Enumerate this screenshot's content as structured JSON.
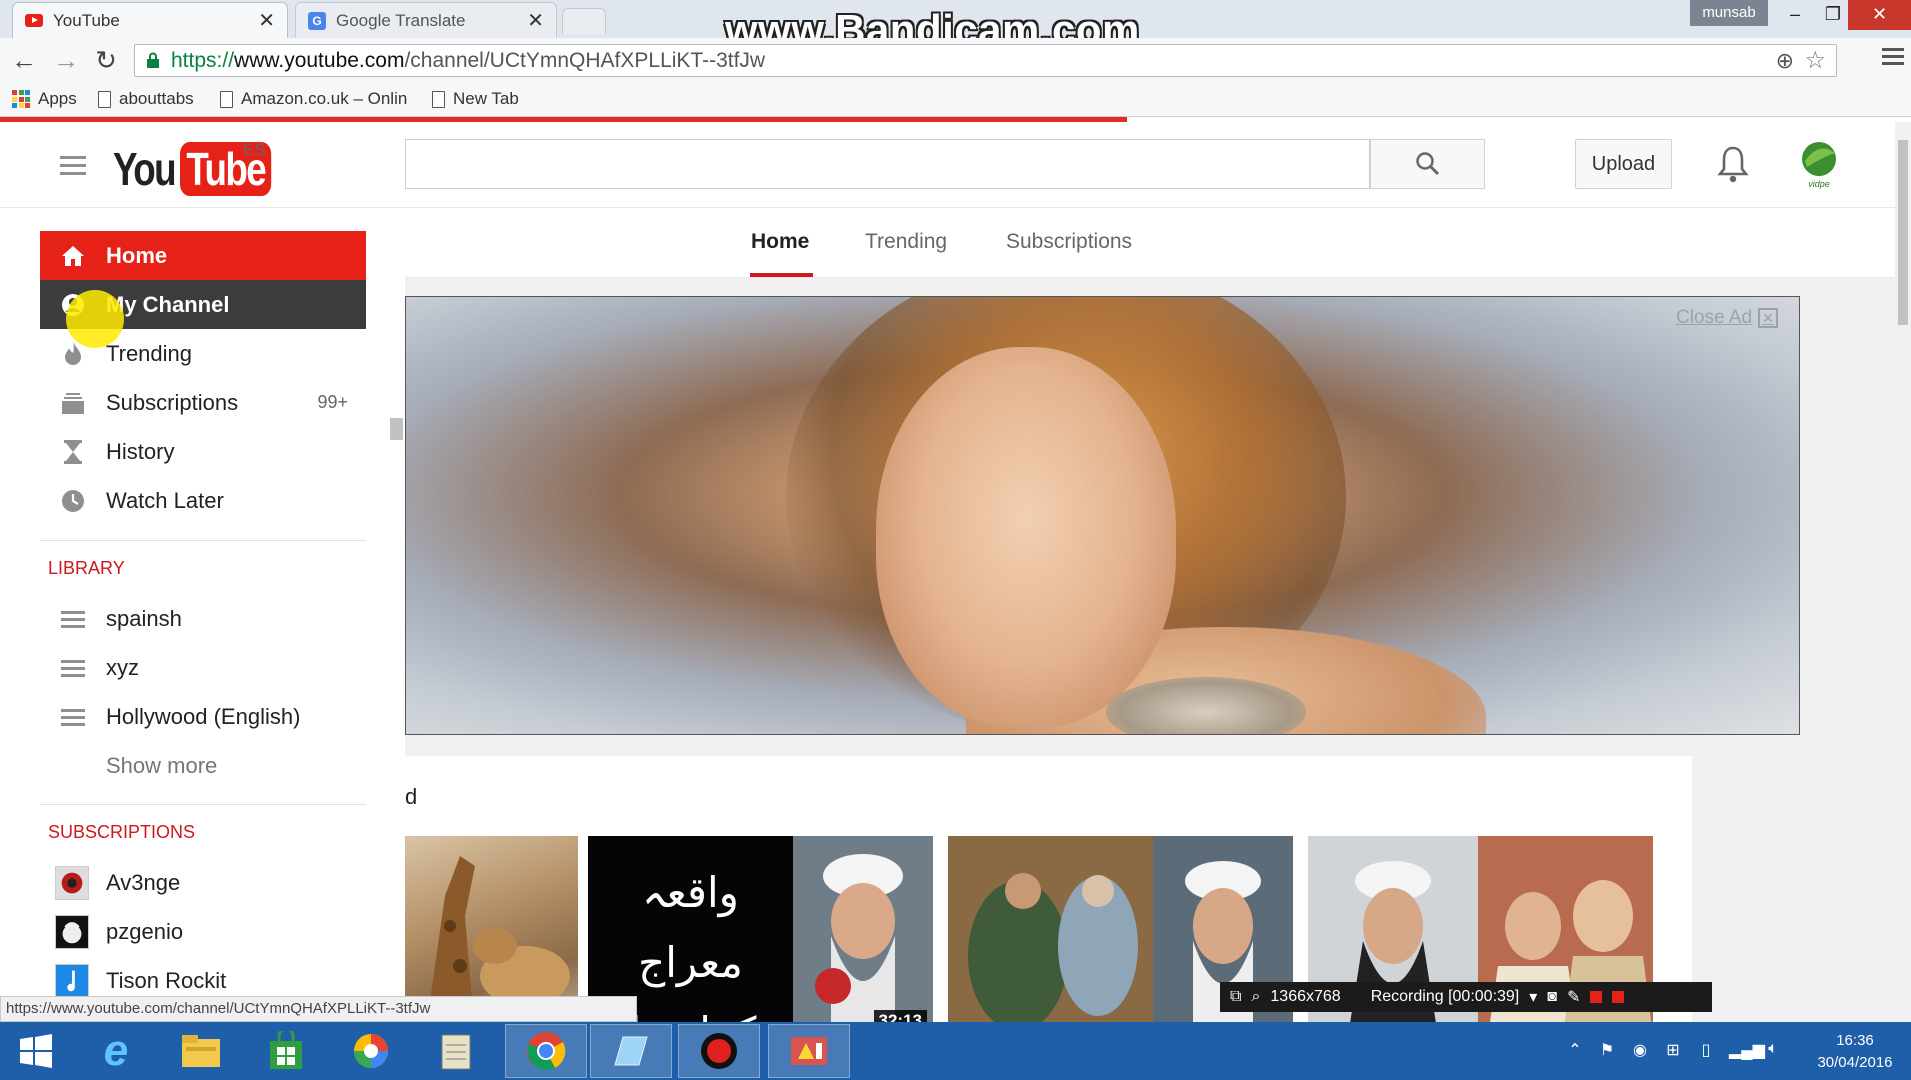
{
  "browser": {
    "tabs": [
      {
        "title": "YouTube",
        "close": "✕"
      },
      {
        "title": "Google Translate",
        "close": "✕"
      }
    ],
    "watermark": "www.Bandicam.com",
    "user": "munsab",
    "url": {
      "scheme": "https://",
      "host": "www.youtube.com",
      "path": "/channel/UCtYmnQHAfXPLLiKT--3tfJw"
    },
    "bookmarks": [
      "Apps",
      "abouttabs",
      "Amazon.co.uk – Onlin",
      "New Tab"
    ],
    "status_url": "https://www.youtube.com/channel/UCtYmnQHAfXPLLiKT--3tfJw"
  },
  "youtube": {
    "logo": {
      "you": "You",
      "tube": "Tube",
      "region": "ES"
    },
    "search": {
      "placeholder": ""
    },
    "upload": "Upload",
    "accent": "#e62117",
    "sidebar": {
      "items": [
        {
          "label": "Home",
          "icon": "home-icon"
        },
        {
          "label": "My Channel",
          "icon": "account-icon"
        },
        {
          "label": "Trending",
          "icon": "flame-icon"
        },
        {
          "label": "Subscriptions",
          "icon": "subscriptions-icon",
          "count": "99+"
        },
        {
          "label": "History",
          "icon": "hourglass-icon"
        },
        {
          "label": "Watch Later",
          "icon": "clock-icon"
        }
      ],
      "library_heading": "LIBRARY",
      "library": [
        "spainsh",
        "xyz",
        "Hollywood (English)"
      ],
      "show_more": "Show more",
      "subscriptions_heading": "SUBSCRIPTIONS",
      "subscriptions": [
        "Av3nge",
        "pzgenio",
        "Tison Rockit"
      ]
    },
    "feed_tabs": [
      "Home",
      "Trending",
      "Subscriptions"
    ],
    "ad": {
      "close": "Close Ad",
      "close_x": "✕"
    },
    "shelf": {
      "letter": "d",
      "thumb_title_urdu": "واقعہ معراج مکمل بیان",
      "durations": [
        "32:13"
      ]
    }
  },
  "recorder": {
    "resolution": "1366x768",
    "status": "Recording [00:00:39]"
  },
  "taskbar": {
    "time": "16:36",
    "date": "30/04/2016"
  }
}
